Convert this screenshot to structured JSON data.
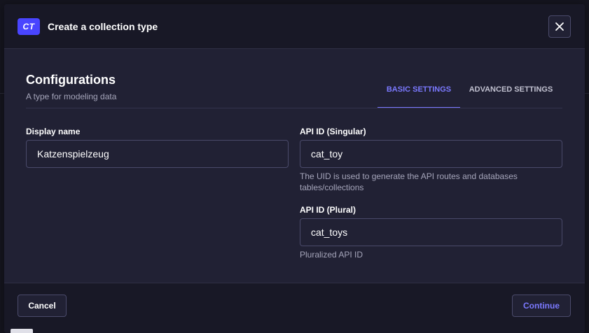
{
  "header": {
    "badge": "CT",
    "title": "Create a collection type",
    "close_icon": "close-icon"
  },
  "section": {
    "title": "Configurations",
    "subtitle": "A type for modeling data"
  },
  "tabs": [
    {
      "label": "BASIC SETTINGS",
      "active": true
    },
    {
      "label": "ADVANCED SETTINGS",
      "active": false
    }
  ],
  "fields": {
    "display_name": {
      "label": "Display name",
      "value": "Katzenspielzeug"
    },
    "api_singular": {
      "label": "API ID (Singular)",
      "value": "cat_toy",
      "hint": "The UID is used to generate the API routes and databases tables/collections"
    },
    "api_plural": {
      "label": "API ID (Plural)",
      "value": "cat_toys",
      "hint": "Pluralized API ID"
    }
  },
  "footer": {
    "cancel_label": "Cancel",
    "continue_label": "Continue"
  },
  "colors": {
    "accent": "#4945ff",
    "accent_text": "#7b79ff",
    "dialog_bg": "#212134",
    "header_bg": "#181826"
  }
}
